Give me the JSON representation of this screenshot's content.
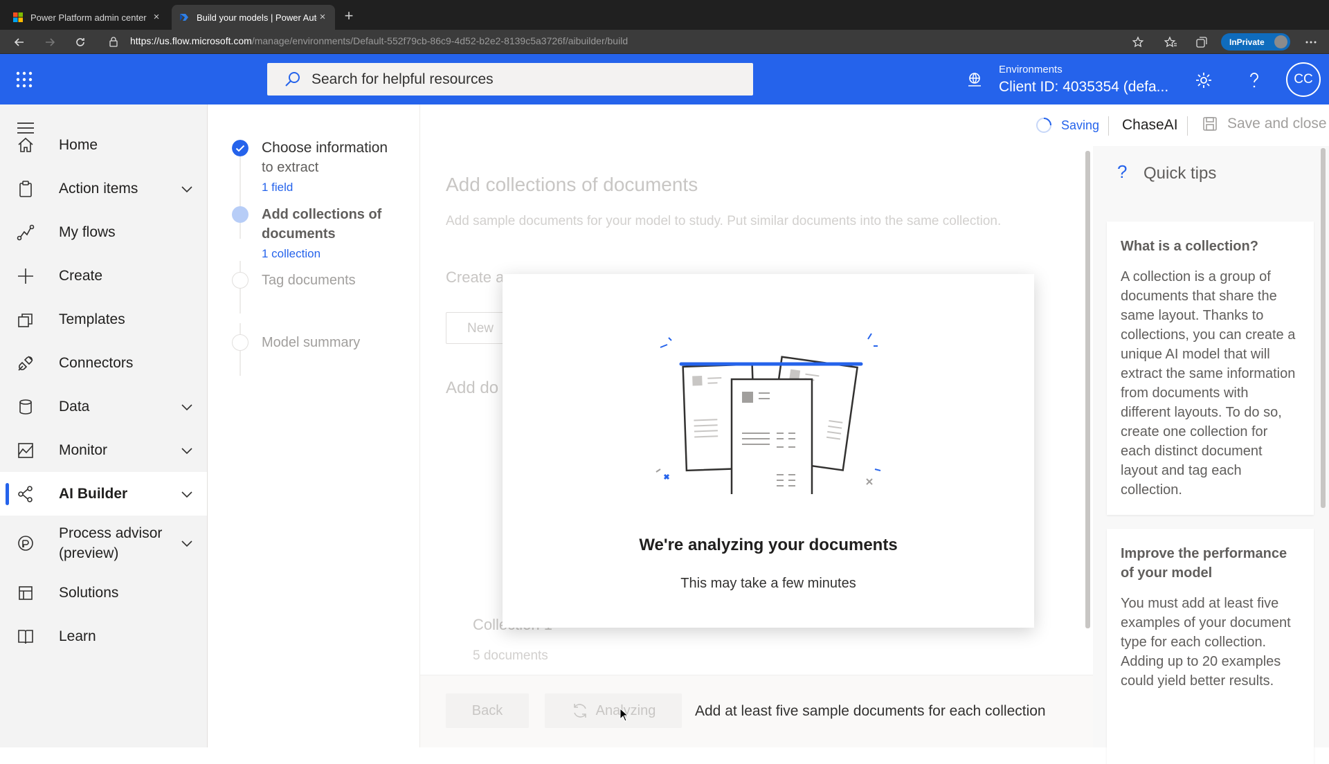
{
  "browser": {
    "tabs": [
      {
        "title": "Power Platform admin center",
        "active": false
      },
      {
        "title": "Build your models | Power Automate",
        "active": true
      }
    ],
    "url_host": "https://us.flow.microsoft.com",
    "url_path": "/manage/environments/Default-552f79cb-86c9-4d52-b2e2-8139c5a3726f/aibuilder/build",
    "inprivate_label": "InPrivate"
  },
  "header": {
    "search_placeholder": "Search for helpful resources",
    "env_label": "Environments",
    "env_value": "Client ID: 4035354 (defa...",
    "avatar_initials": "CC",
    "brand_color": "#2563eb"
  },
  "nav": {
    "items": [
      {
        "label": "Home",
        "icon": "home-icon",
        "chevron": false
      },
      {
        "label": "Action items",
        "icon": "clipboard-icon",
        "chevron": true
      },
      {
        "label": "My flows",
        "icon": "flow-icon",
        "chevron": false
      },
      {
        "label": "Create",
        "icon": "plus-icon",
        "chevron": false
      },
      {
        "label": "Templates",
        "icon": "templates-icon",
        "chevron": false
      },
      {
        "label": "Connectors",
        "icon": "connector-icon",
        "chevron": false
      },
      {
        "label": "Data",
        "icon": "database-icon",
        "chevron": true
      },
      {
        "label": "Monitor",
        "icon": "monitor-icon",
        "chevron": true
      },
      {
        "label": "AI Builder",
        "icon": "ai-builder-icon",
        "chevron": true,
        "active": true
      },
      {
        "label": "Process advisor (preview)",
        "icon": "process-advisor-icon",
        "chevron": true
      },
      {
        "label": "Solutions",
        "icon": "solutions-icon",
        "chevron": false
      },
      {
        "label": "Learn",
        "icon": "book-icon",
        "chevron": false
      }
    ]
  },
  "stepper": {
    "steps": [
      {
        "title_line1": "Choose information",
        "title_line2": "to extract",
        "sub": "1 field",
        "state": "done"
      },
      {
        "title_line1": "Add collections of",
        "title_line2": "documents",
        "sub": "1 collection",
        "state": "current"
      },
      {
        "title_line1": "Tag documents",
        "state": "pending"
      },
      {
        "title_line1": "Model summary",
        "state": "pending"
      }
    ]
  },
  "command_bar": {
    "saving_label": "Saving",
    "model_name": "ChaseAI",
    "save_close_label": "Save and close"
  },
  "main": {
    "title": "Add collections of documents",
    "description": "Add sample documents for your model to study. Put similar documents into the same collection.",
    "create_heading": "Create a",
    "new_button": "New",
    "add_docs_heading": "Add do",
    "collection_name": "Collection 1",
    "collection_count": "5 documents"
  },
  "footer": {
    "back_label": "Back",
    "analyze_label": "Analyzing",
    "hint": "Add at least five sample documents for each collection"
  },
  "modal": {
    "title": "We're analyzing your documents",
    "subtitle": "This may take a few minutes"
  },
  "tips": {
    "title": "Quick tips",
    "cards": [
      {
        "heading": "What is a collection?",
        "body": "A collection is a group of documents that share the same layout. Thanks to collections, you can create a unique AI model that will extract the same information from documents with different layouts. To do so, create one collection for each distinct document layout and tag each collection."
      },
      {
        "heading": "Improve the performance of your model",
        "body": "You must add at least five examples of your document type for each collection. Adding up to 20 examples could yield better results."
      }
    ]
  }
}
